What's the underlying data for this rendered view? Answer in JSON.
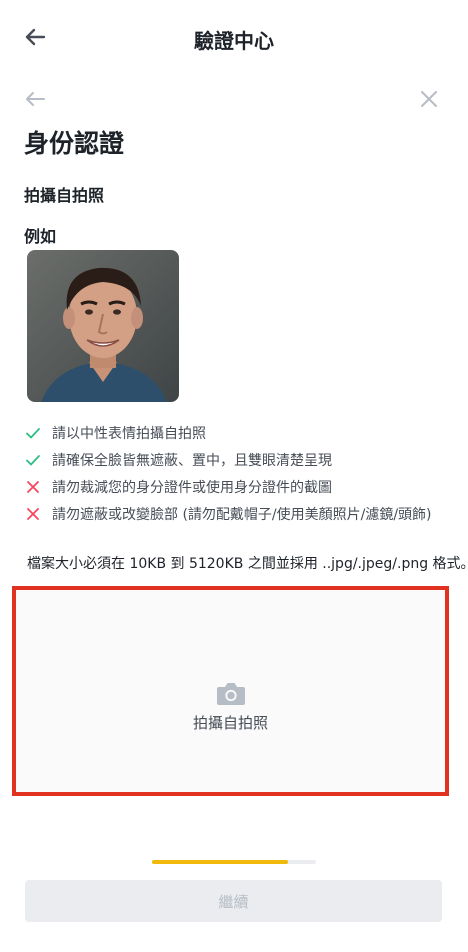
{
  "header": {
    "title": "驗證中心",
    "back_icon": "arrow-left-icon"
  },
  "sub_nav": {
    "back_icon": "arrow-left-icon",
    "close_icon": "close-icon"
  },
  "page": {
    "heading": "身份認證",
    "section_title": "拍攝自拍照",
    "example_label": "例如",
    "example_photo": "selfie-example-photo"
  },
  "rules": [
    {
      "type": "ok",
      "icon": "check-icon",
      "text": "請以中性表情拍攝自拍照"
    },
    {
      "type": "ok",
      "icon": "check-icon",
      "text": "請確保全臉皆無遮蔽、置中，且雙眼清楚呈現"
    },
    {
      "type": "bad",
      "icon": "cross-icon",
      "text": "請勿裁減您的身分證件或使用身分證件的截圖"
    },
    {
      "type": "bad",
      "icon": "cross-icon",
      "text": "請勿遮蔽或改變臉部 (請勿配戴帽子/使用美顏照片/濾鏡/頭飾)"
    }
  ],
  "file_note": "檔案大小必須在 10KB 到 5120KB 之間並採用 ..jpg/.jpeg/.png 格式。",
  "upload": {
    "label": "拍攝自拍照",
    "icon": "camera-icon"
  },
  "progress": {
    "fraction": 0.83
  },
  "continue_button": {
    "label": "繼續",
    "disabled": true
  },
  "colors": {
    "check": "#2ebd85",
    "cross": "#f6465d",
    "highlight_border": "#e03121",
    "progress": "#f0b90b",
    "text": "#1e2329",
    "muted": "#474d57"
  }
}
